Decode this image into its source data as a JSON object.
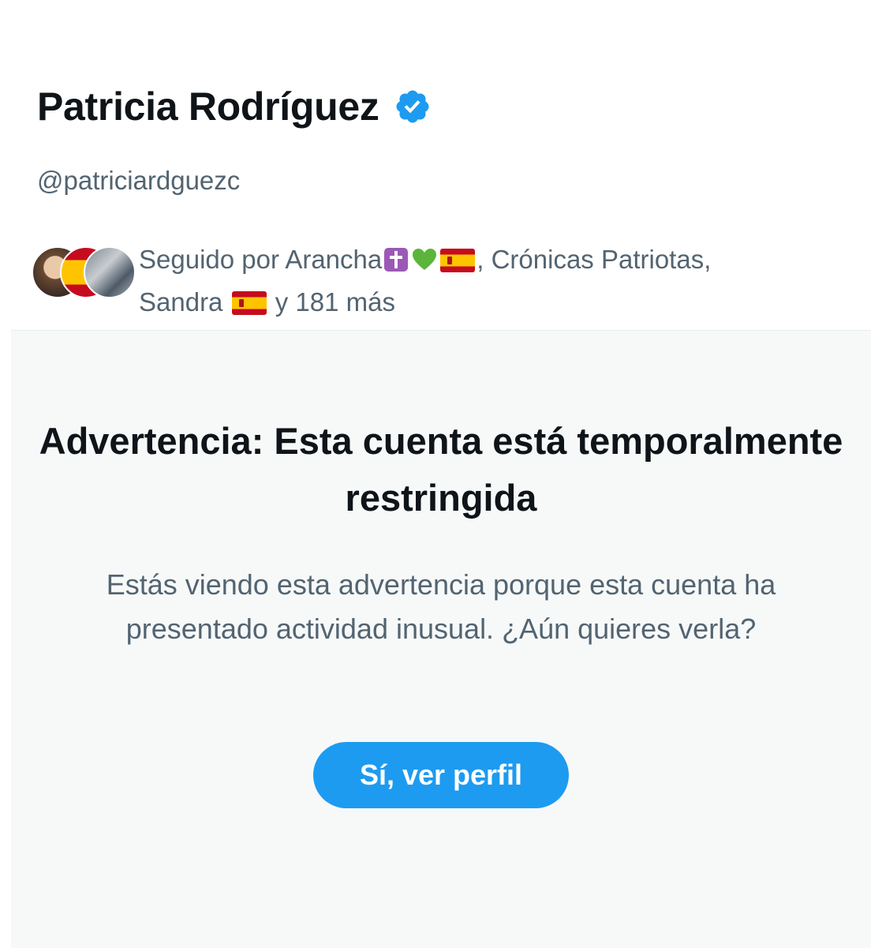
{
  "profile": {
    "display_name": "Patricia Rodríguez",
    "handle": "@patriciardguezc",
    "verified_icon": "verified-badge-icon",
    "accent_color": "#1d9bf0"
  },
  "followed_by": {
    "prefix": "Seguido por ",
    "name1": "Arancha",
    "name1_emojis": [
      "latin-cross-icon",
      "green-heart-icon",
      "spain-flag-icon"
    ],
    "separator1": ", ",
    "name2": "Crónicas Patriotas,",
    "name3": "Sandra",
    "name3_emojis": [
      "spain-flag-icon"
    ],
    "suffix": " y 181 más"
  },
  "warning": {
    "title": "Advertencia: Esta cuenta está temporalmente restringida",
    "body": "Estás viendo esta advertencia porque esta cuenta ha presentado actividad inusual. ¿Aún quieres verla?",
    "button_label": "Sí, ver perfil"
  }
}
